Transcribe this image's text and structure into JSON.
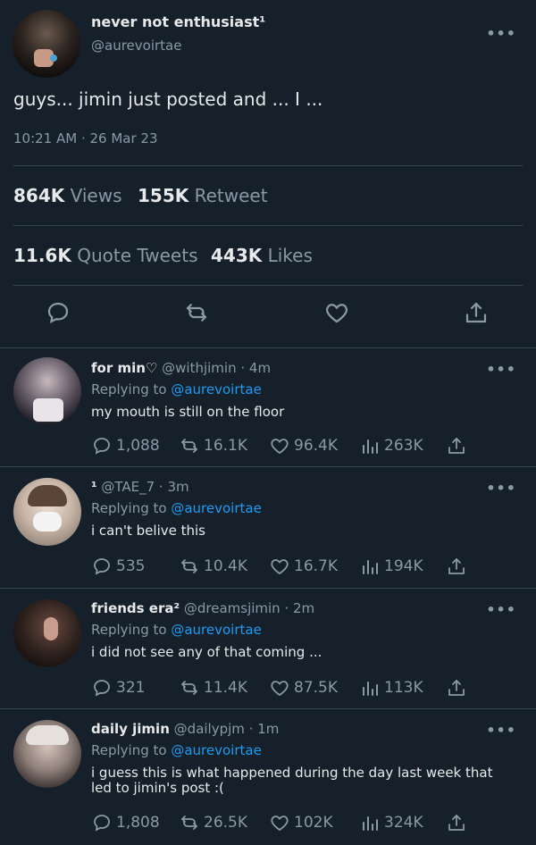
{
  "main_tweet": {
    "display_name": "never not enthusiast¹",
    "handle": "@aurevoirtae",
    "text": "guys... jimin just posted and ... I ...",
    "timestamp": "10:21 AM · 26 Mar 23",
    "stats": {
      "views_value": "864K",
      "views_label": "Views",
      "retweets_value": "155K",
      "retweets_label": "Retweet",
      "quotes_value": "11.6K",
      "quotes_label": "Quote Tweets",
      "likes_value": "443K",
      "likes_label": "Likes"
    },
    "more_label": "•••"
  },
  "replies": [
    {
      "name": "for min♡",
      "handle": "@withjimin",
      "time": "· 4m",
      "replying_prefix": "Replying to",
      "replying_to": "@aurevoirtae",
      "text": "my mouth is still on the floor",
      "replies": "1,088",
      "retweets": "16.1K",
      "likes": "96.4K",
      "views": "263K",
      "more_label": "•••"
    },
    {
      "name": "¹",
      "handle": "@TAE_7",
      "time": "· 3m",
      "replying_prefix": "Replying to",
      "replying_to": "@aurevoirtae",
      "text": "i can't belive this",
      "replies": "535",
      "retweets": "10.4K",
      "likes": "16.7K",
      "views": "194K",
      "more_label": "•••"
    },
    {
      "name": "friends era²",
      "handle": "@dreamsjimin",
      "time": "· 2m",
      "replying_prefix": "Replying to",
      "replying_to": "@aurevoirtae",
      "text": "i did not see any of that coming ...",
      "replies": "321",
      "retweets": "11.4K",
      "likes": "87.5K",
      "views": "113K",
      "more_label": "•••"
    },
    {
      "name": "daily jimin",
      "handle": "@dailypjm",
      "time": "· 1m",
      "replying_prefix": "Replying to",
      "replying_to": "@aurevoirtae",
      "text": "i guess this is what happened during the day last week that led to jimin's post :(",
      "replies": "1,808",
      "retweets": "26.5K",
      "likes": "102K",
      "views": "324K",
      "more_label": "•••"
    }
  ],
  "colors": {
    "background": "#15202b",
    "text": "#e7e9ea",
    "muted": "#8b98a5",
    "link": "#1d9bf0",
    "separator": "#38444d"
  }
}
